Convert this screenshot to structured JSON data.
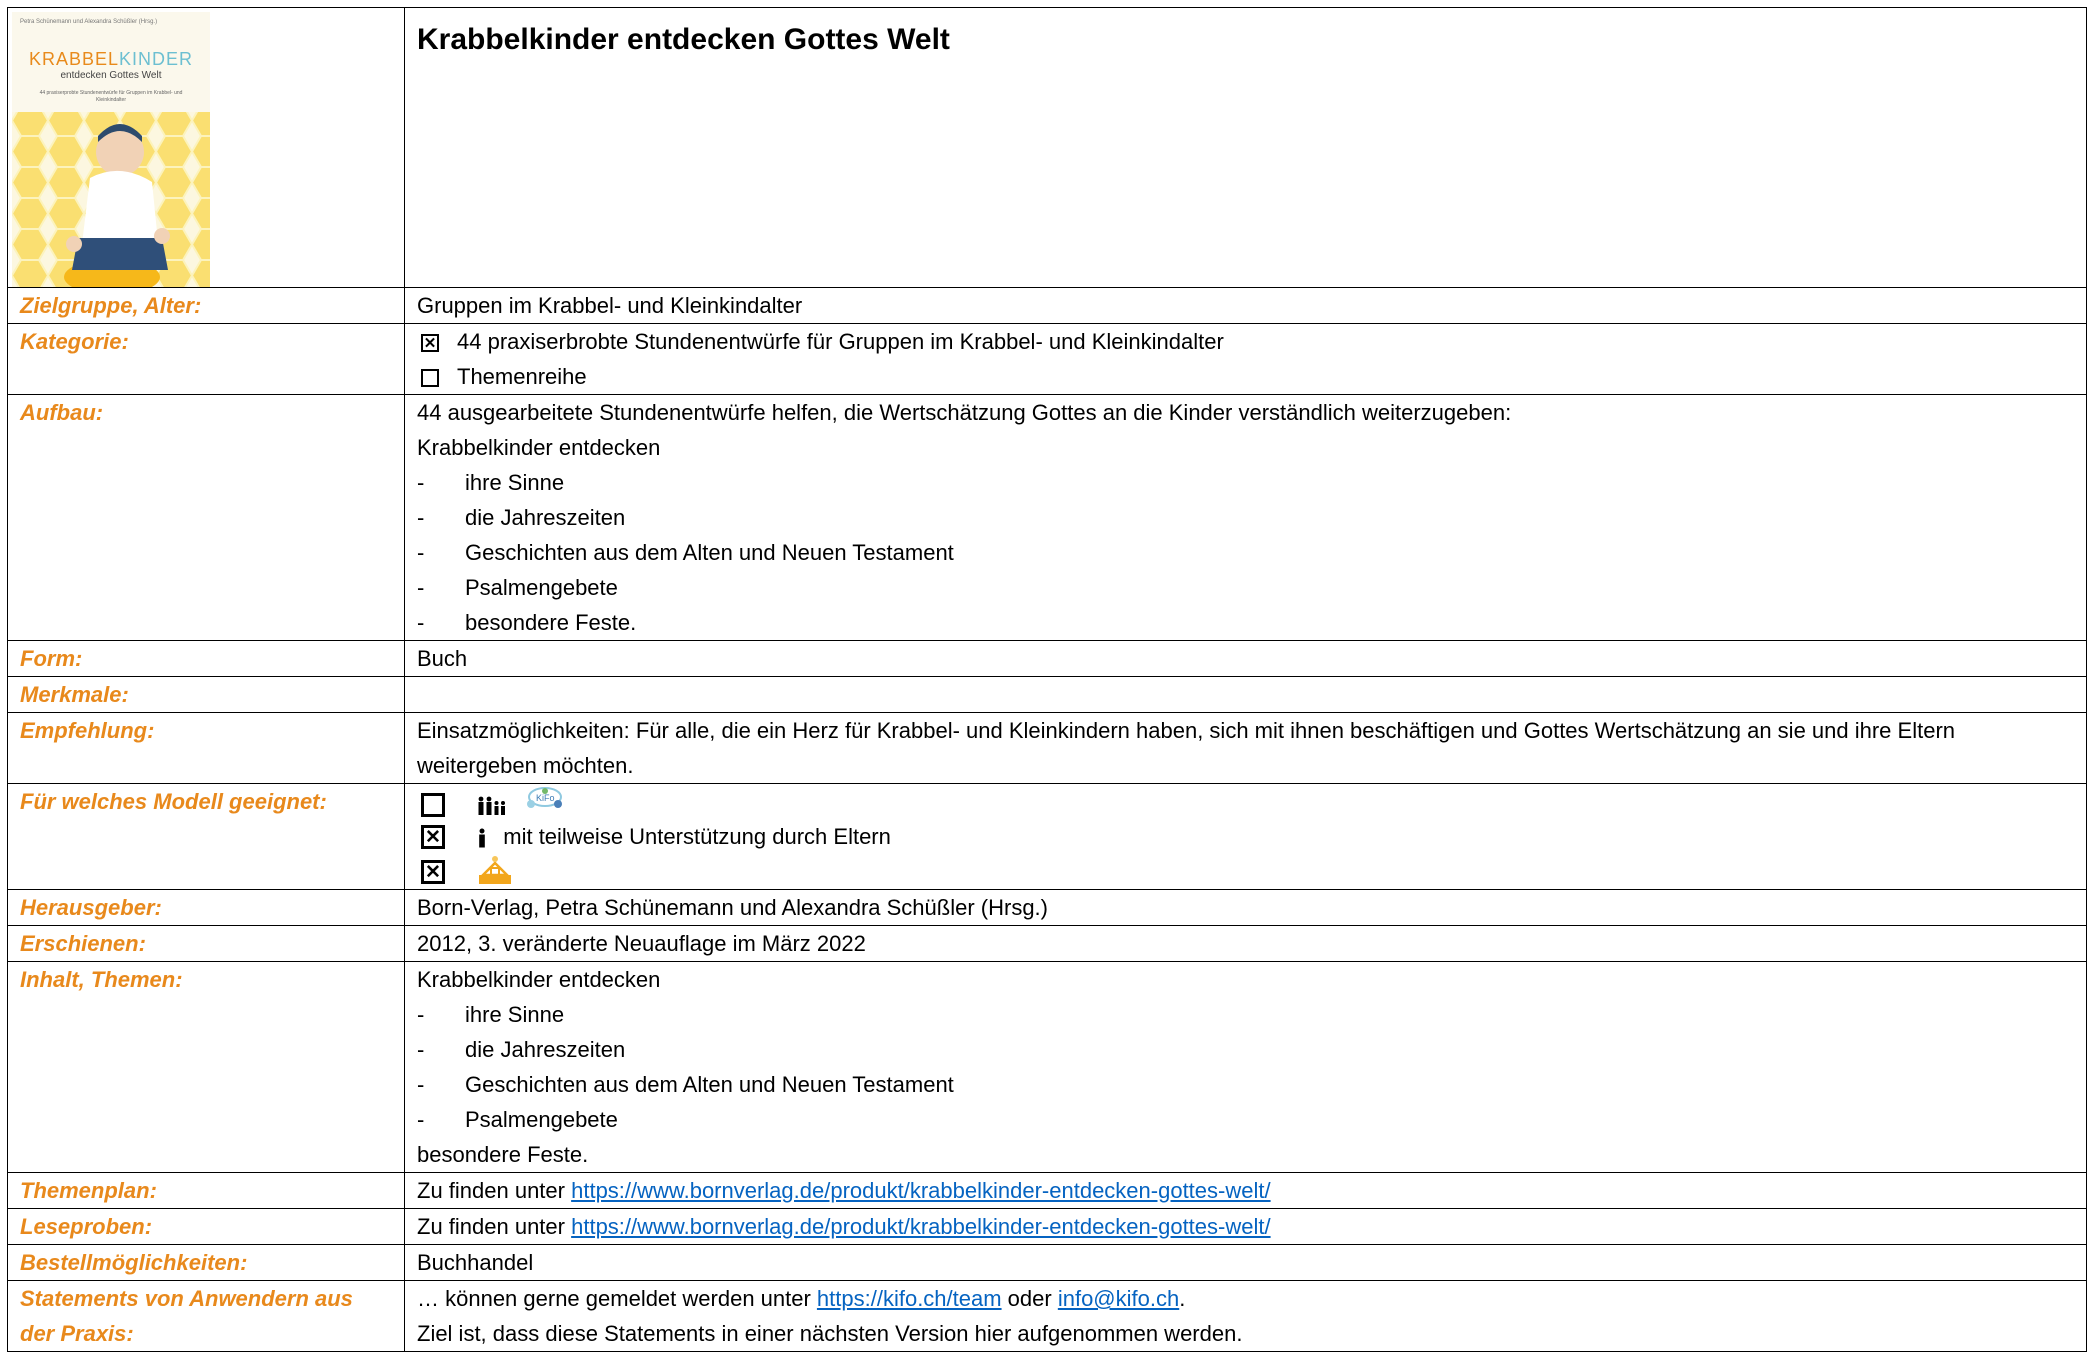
{
  "header": {
    "title": "Krabbelkinder entdecken Gottes Welt",
    "cover": {
      "top_text": "Petra Schünemann und Alexandra Schüßler (Hrsg.)",
      "brand_a": "KRABBEL",
      "brand_b": "KINDER",
      "subtitle": "entdecken Gottes Welt",
      "tagline": "44 praxiserprobte Stundenentwürfe für Gruppen im Krabbel- und Kleinkindalter"
    }
  },
  "rows": {
    "zielgruppe": {
      "label": "Zielgruppe, Alter:",
      "value": "Gruppen im Krabbel- und Kleinkindalter"
    },
    "kategorie": {
      "label": "Kategorie:",
      "options": [
        {
          "text": "44 praxiserbrobte Stundenentwürfe für Gruppen im Krabbel- und Kleinkindalter",
          "checked": true
        },
        {
          "text": "Themenreihe",
          "checked": false
        }
      ]
    },
    "aufbau": {
      "label": "Aufbau:",
      "intro": "44 ausgearbeitete Stundenentwürfe helfen, die Wertschätzung Gottes an die Kinder verständlich weiterzugeben:",
      "lead": "Krabbelkinder entdecken",
      "items": [
        "ihre Sinne",
        "die Jahreszeiten",
        "Geschichten aus dem Alten und Neuen Testament",
        "Psalmengebete",
        "besondere Feste."
      ]
    },
    "form": {
      "label": "Form:",
      "value": "Buch"
    },
    "merkmale": {
      "label": "Merkmale:",
      "value": ""
    },
    "empfehlung": {
      "label": "Empfehlung:",
      "value": "Einsatzmöglichkeiten: Für alle, die ein Herz für Krabbel- und Kleinkindern haben, sich mit ihnen beschäftigen und Gottes Wertschätzung an sie und ihre Eltern weitergeben möchten."
    },
    "modell": {
      "label": "Für welches Modell geeignet:",
      "options": [
        {
          "text": "",
          "checked": false,
          "icons": [
            "family-icon",
            "kifo-logo-icon"
          ]
        },
        {
          "text": "mit teilweise Unterstützung durch Eltern",
          "checked": true,
          "icons": [
            "person-icon"
          ]
        },
        {
          "text": "",
          "checked": true,
          "icons": [
            "kifo-house-icon"
          ]
        }
      ]
    },
    "herausgeber": {
      "label": "Herausgeber:",
      "value": "Born-Verlag, Petra Schünemann und Alexandra Schüßler (Hrsg.)"
    },
    "erschienen": {
      "label": "Erschienen:",
      "value": "2012, 3. veränderte Neuauflage im März 2022"
    },
    "inhalt": {
      "label": "Inhalt, Themen:",
      "lead": "Krabbelkinder entdecken",
      "items": [
        "ihre Sinne",
        "die Jahreszeiten",
        "Geschichten aus dem Alten und Neuen Testament",
        "Psalmengebete"
      ],
      "tail": "besondere Feste."
    },
    "themenplan": {
      "label": "Themenplan:",
      "prefix": "Zu finden unter ",
      "link": "https://www.bornverlag.de/produkt/krabbelkinder-entdecken-gottes-welt/"
    },
    "leseproben": {
      "label": "Leseproben:",
      "prefix": "Zu finden unter ",
      "link": "https://www.bornverlag.de/produkt/krabbelkinder-entdecken-gottes-welt/"
    },
    "bestell": {
      "label": "Bestellmöglichkeiten:",
      "value": "Buchhandel"
    },
    "statements": {
      "label": "Statements von Anwendern aus der Praxis:",
      "prefix": "… können gerne gemeldet werden unter ",
      "link1": "https://kifo.ch/team",
      "mid": " oder ",
      "link2": "info@kifo.ch",
      "suffix": ".",
      "line2": "Ziel ist, dass diese Statements in einer nächsten Version hier aufgenommen werden."
    }
  },
  "colors": {
    "label": "#e8891c",
    "link": "#0563c1",
    "border": "#000000"
  }
}
